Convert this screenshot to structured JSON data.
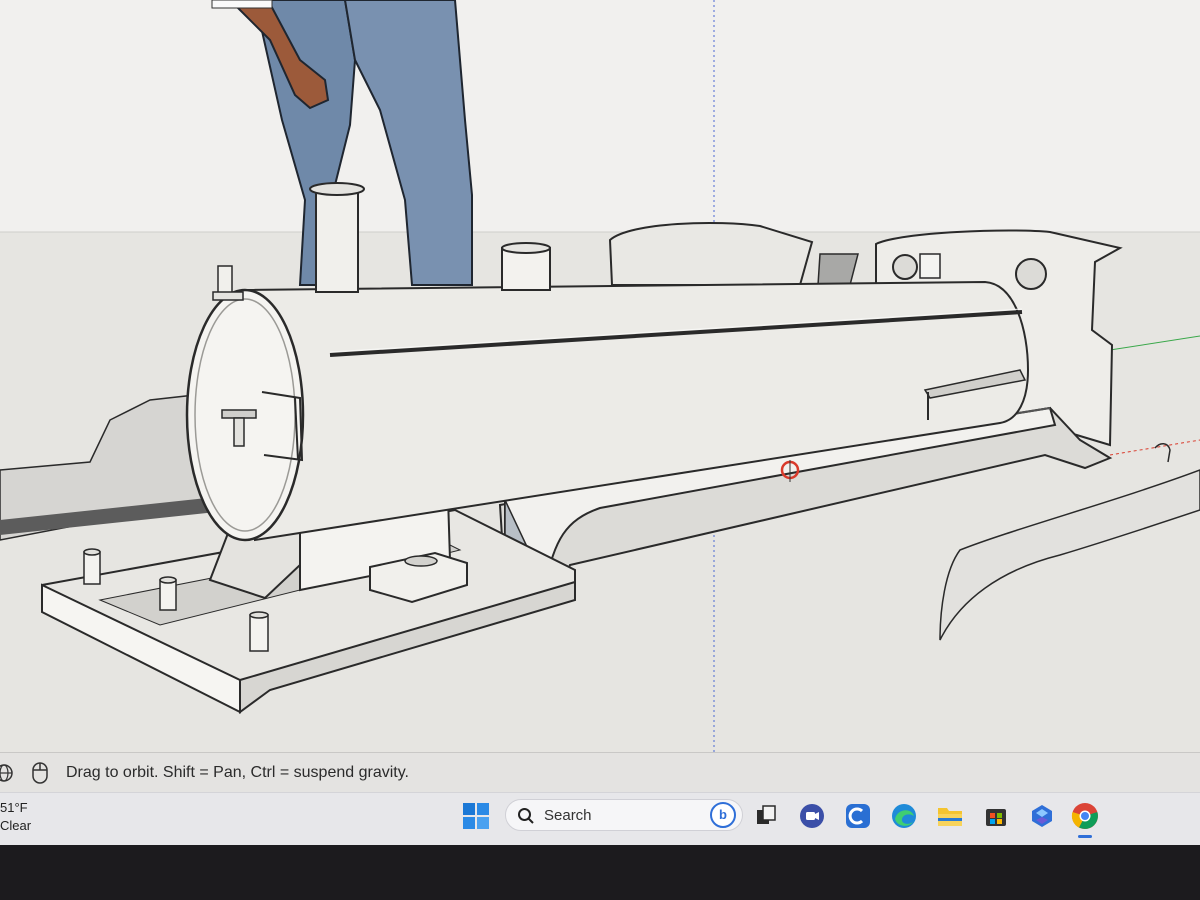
{
  "status_bar": {
    "hint": "Drag to orbit. Shift = Pan, Ctrl = suspend gravity.",
    "icons": [
      "geo-location-icon",
      "mouse-icon"
    ]
  },
  "taskbar": {
    "weather": {
      "temperature": "51°F",
      "condition": "Clear"
    },
    "search": {
      "label": "Search",
      "badge_icon": "bing-chat-icon"
    },
    "apps": [
      "windows-start-icon",
      "task-view-icon",
      "video-call-icon",
      "ccleaner-icon",
      "edge-browser-icon",
      "file-explorer-icon",
      "store-icon",
      "copilot-icon",
      "chrome-icon"
    ]
  },
  "colors": {
    "model_fill": "#ebebe7",
    "model_shade": "#d3d3cf",
    "outline": "#2a2a2a",
    "jeans": "#6f89a9",
    "accent_blue": "#2f6fd8",
    "axis_red": "#d93a2b",
    "axis_green": "#3aa84a"
  }
}
